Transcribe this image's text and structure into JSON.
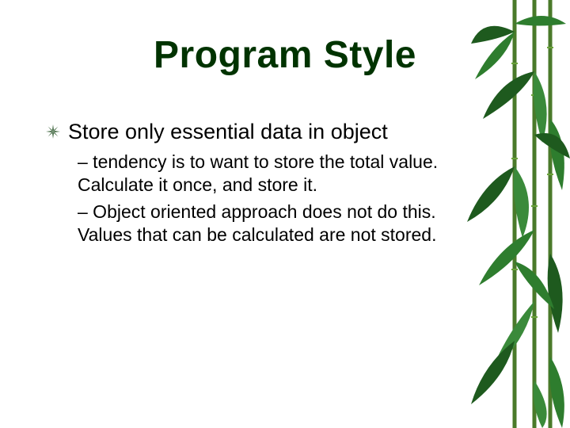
{
  "slide": {
    "title": "Program Style",
    "bullet": "Store only essential data in object",
    "sub1": "– tendency is to want to store the total value. Calculate it once, and store it.",
    "sub2": "– Object oriented approach does not do this. Values that can be calculated are not stored."
  }
}
